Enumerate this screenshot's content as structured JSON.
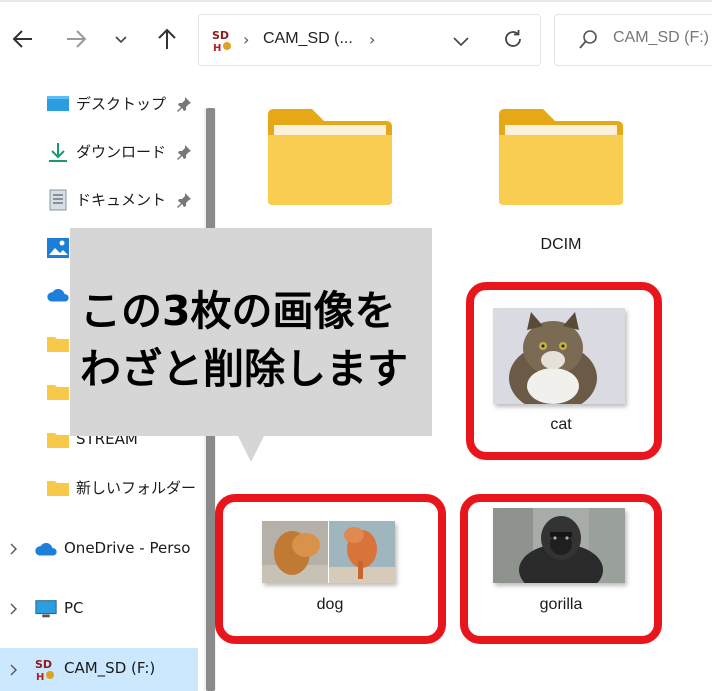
{
  "addressbar": {
    "drive_text": "CAM_SD (...",
    "separator": "›"
  },
  "search": {
    "placeholder": "CAM_SD (F:)"
  },
  "sidebar": {
    "items": [
      {
        "label": "デスクトップ",
        "icon": "desktop-icon",
        "pinned": true
      },
      {
        "label": "ダウンロード",
        "icon": "download-icon",
        "pinned": true
      },
      {
        "label": "ドキュメント",
        "icon": "document-icon",
        "pinned": true
      },
      {
        "label": "STREAM",
        "icon": "folder-icon",
        "pinned": false
      },
      {
        "label": "新しいフォルダー",
        "icon": "folder-icon",
        "pinned": false
      },
      {
        "label": "OneDrive - Perso",
        "icon": "onedrive-icon",
        "pinned": false
      },
      {
        "label": "PC",
        "icon": "pc-icon",
        "pinned": false
      },
      {
        "label": "CAM_SD (F:)",
        "icon": "sd-card-icon",
        "pinned": false,
        "selected": true
      }
    ]
  },
  "content": {
    "items": [
      {
        "label": "",
        "type": "folder"
      },
      {
        "label": "DCIM",
        "type": "folder"
      },
      {
        "label": "cat",
        "type": "image",
        "highlighted": true
      },
      {
        "label": "dog",
        "type": "image",
        "highlighted": true
      },
      {
        "label": "gorilla",
        "type": "image",
        "highlighted": true
      }
    ]
  },
  "callout": {
    "line1": "この3枚の画像を",
    "line2": "わざと削除します"
  },
  "colors": {
    "highlight": "#e8161c",
    "selected": "#cce8ff",
    "folder": "#f7c948",
    "callout_bg": "#d6d6d6"
  }
}
